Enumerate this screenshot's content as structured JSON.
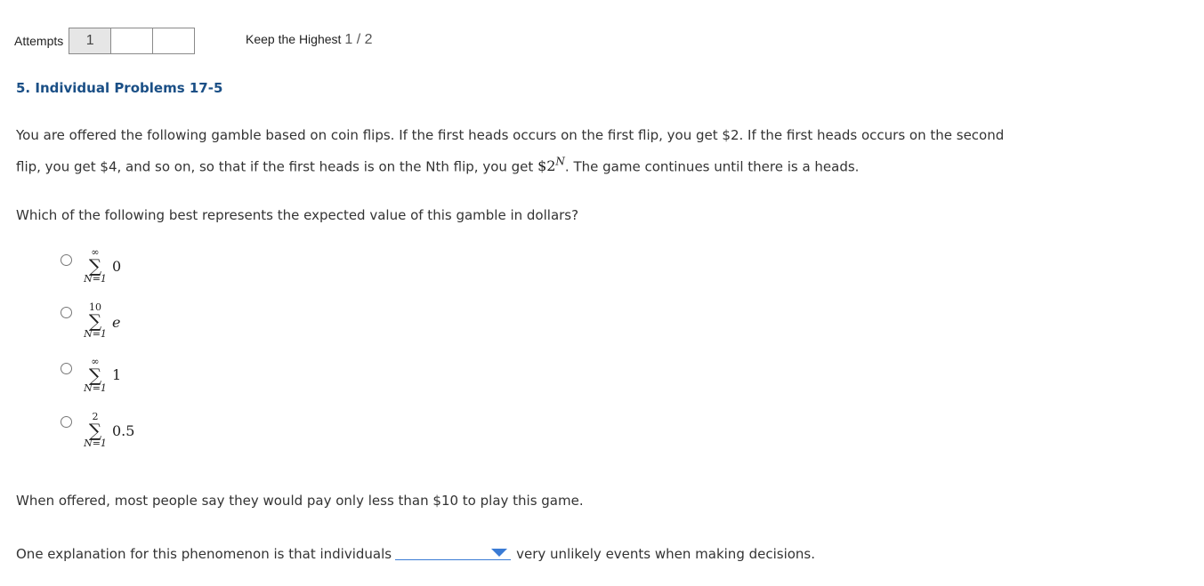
{
  "attempts": {
    "label": "Attempts",
    "boxes": [
      "1",
      "",
      ""
    ]
  },
  "keep_highest": {
    "label": "Keep the Highest",
    "score": "1 / 2"
  },
  "problem": {
    "title": "5. Individual Problems 17-5",
    "intro_line1": "You are offered the following gamble based on coin flips. If the first heads occurs on the first flip, you get $2. If the first heads occurs on the second",
    "intro_line2_before": "flip, you get $4, and so on, so that if the first heads is on the Nth flip, you get ",
    "intro_math_base": "$2",
    "intro_math_exp": "N",
    "intro_line2_after": ". The game continues until there is a heads.",
    "question": "Which of the following best represents the expected value of this gamble in dollars?",
    "choices": [
      {
        "upper": "∞",
        "lower": "N=1",
        "summand": "0",
        "italic": false
      },
      {
        "upper": "10",
        "lower": "N=1",
        "summand": "e",
        "italic": true
      },
      {
        "upper": "∞",
        "lower": "N=1",
        "summand": "1",
        "italic": false
      },
      {
        "upper": "2",
        "lower": "N=1",
        "summand": "0.5",
        "italic": false
      }
    ],
    "sigma": "∑",
    "statement": "When offered, most people say they would pay only less than $10 to play this game.",
    "explanation_before": "One explanation for this phenomenon is that individuals",
    "explanation_after": "very unlikely events when making decisions.",
    "dropdown_value": ""
  },
  "colors": {
    "title": "#1a4f86",
    "dropdown_accent": "#3a7bd5",
    "used_attempt_bg": "#e6e6e6"
  }
}
